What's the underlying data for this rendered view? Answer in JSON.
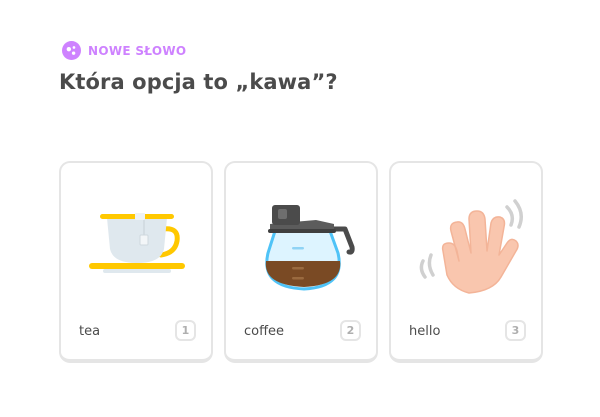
{
  "header": {
    "badge_icon": "new-word-sparkle-icon",
    "badge_label": "NOWE SŁOWO",
    "question": "Która opcja to „kawa”?"
  },
  "choices": [
    {
      "label": "tea",
      "key": "1",
      "illustration": "teacup-icon"
    },
    {
      "label": "coffee",
      "key": "2",
      "illustration": "coffee-pot-icon"
    },
    {
      "label": "hello",
      "key": "3",
      "illustration": "waving-hand-icon"
    }
  ],
  "colors": {
    "accent_purple": "#ce82ff",
    "text": "#4b4b4b",
    "border": "#e5e5e5",
    "muted": "#afafaf"
  }
}
